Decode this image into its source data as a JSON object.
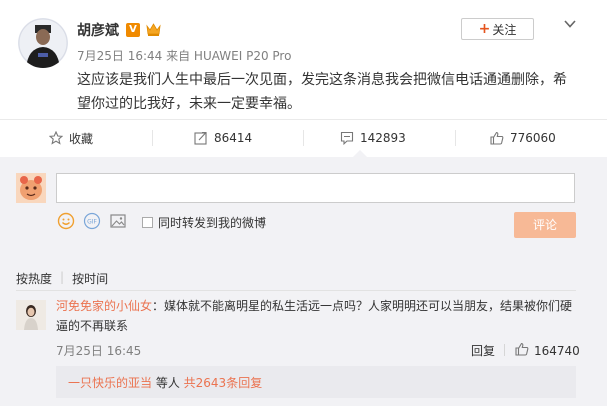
{
  "post": {
    "author": "胡彦斌",
    "verified_badge": "V",
    "meta": "7月25日 16:44 来自 HUAWEI P20 Pro",
    "follow_label": "关注",
    "text": "这应该是我们人生中最后一次见面，发完这条消息我会把微信电话通通删除，希望你过的比我好，未来一定要幸福。"
  },
  "actions": {
    "favorite_label": "收藏",
    "repost_count": "86414",
    "comment_count": "142893",
    "like_count": "776060"
  },
  "composer": {
    "repost_to_weibo_label": "同时转发到我的微博",
    "submit_label": "评论"
  },
  "sort": {
    "by_hot": "按热度",
    "by_time": "按时间"
  },
  "comment": {
    "user": "河免免家的小仙女",
    "text": "：媒体就不能离明星的私生活远一点吗？人家明明还可以当朋友，结果被你们硬逼的不再联系",
    "time": "7月25日 16:45",
    "reply_label": "回复",
    "like_count": "164740",
    "sub_user": "一只快乐的亚当",
    "sub_mid": " 等人 ",
    "sub_more": "共2643条回复"
  },
  "colors": {
    "accent": "#eb7350",
    "submit_bg": "#f7b996",
    "comment_area_bg": "#f2f2f5"
  },
  "icons": [
    "crown-icon",
    "chevron-down-icon",
    "star-icon",
    "repost-icon",
    "comment-icon",
    "thumbs-up-icon",
    "emoji-icon",
    "gif-icon",
    "image-icon"
  ]
}
